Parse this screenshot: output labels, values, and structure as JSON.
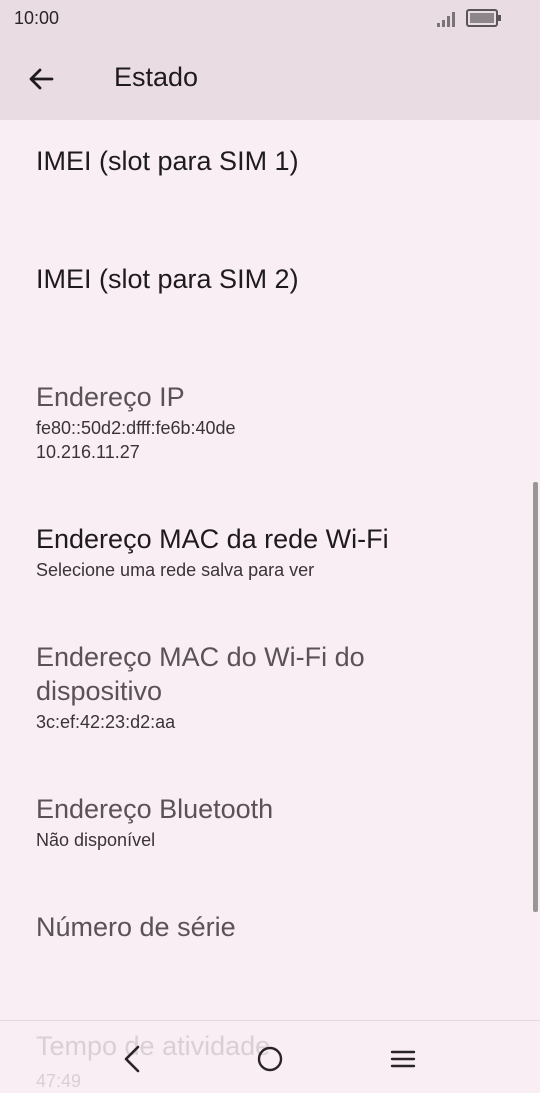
{
  "status_bar": {
    "time": "10:00"
  },
  "app_bar": {
    "title": "Estado"
  },
  "items": [
    {
      "title": "IMEI (slot para SIM 1)",
      "subtitle": ""
    },
    {
      "title": "IMEI (slot para SIM 2)",
      "subtitle": ""
    },
    {
      "title": "Endereço IP",
      "subtitle_lines": [
        "fe80::50d2:dfff:fe6b:40de",
        "10.216.11.27"
      ]
    },
    {
      "title": "Endereço MAC da rede Wi-Fi",
      "subtitle": "Selecione uma rede salva para ver"
    },
    {
      "title_lines": [
        "Endereço MAC do Wi-Fi do",
        "dispositivo"
      ],
      "subtitle": "3c:ef:42:23:d2:aa"
    },
    {
      "title": "Endereço Bluetooth",
      "subtitle": "Não disponível"
    },
    {
      "title": "Número de série",
      "subtitle": ""
    },
    {
      "title": "Tempo de atividade",
      "subtitle": "47:49"
    }
  ],
  "icons": {
    "back": "arrow-left-icon",
    "signal": "cellular-signal-icon",
    "battery": "battery-icon",
    "nav_back": "chevron-left-icon",
    "nav_home": "circle-home-icon",
    "nav_menu": "menu-icon"
  }
}
